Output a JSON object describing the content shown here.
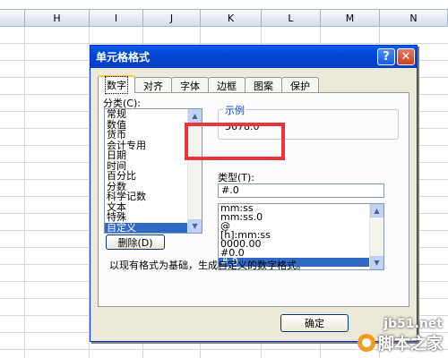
{
  "spreadsheet": {
    "columns": [
      "H",
      "I",
      "J",
      "K",
      "L",
      "M",
      "N"
    ]
  },
  "dialog": {
    "title": "单元格格式",
    "help_label": "?",
    "close_label": "✕",
    "tabs": [
      {
        "label": "数字",
        "active": true
      },
      {
        "label": "对齐",
        "active": false
      },
      {
        "label": "字体",
        "active": false
      },
      {
        "label": "边框",
        "active": false
      },
      {
        "label": "图案",
        "active": false
      },
      {
        "label": "保护",
        "active": false
      }
    ],
    "category_label": "分类(C):",
    "categories": [
      "常规",
      "数值",
      "货币",
      "会计专用",
      "日期",
      "时间",
      "百分比",
      "分数",
      "科学记数",
      "文本",
      "特殊",
      "自定义"
    ],
    "selected_category": "自定义",
    "sample_label": "示例",
    "sample_value": "5678.0",
    "type_label": "类型(T):",
    "type_value": "#.0",
    "formats": [
      "mm:ss",
      "mm:ss.0",
      "@",
      "[h]:mm:ss",
      "0000.00",
      "#0.0",
      "#.0"
    ],
    "selected_format": "#.0",
    "delete_label": "删除(D)",
    "description": "以现有格式为基础，生成自定义的数字格式。",
    "ok_label": "确定"
  },
  "watermark": {
    "site": "jb51.net",
    "name": "脚本之家"
  },
  "colors": {
    "title_bar": "#0a5ee8",
    "selection": "#316ac5",
    "highlight_box": "#e8373a",
    "dialog_face": "#ece9d8"
  }
}
